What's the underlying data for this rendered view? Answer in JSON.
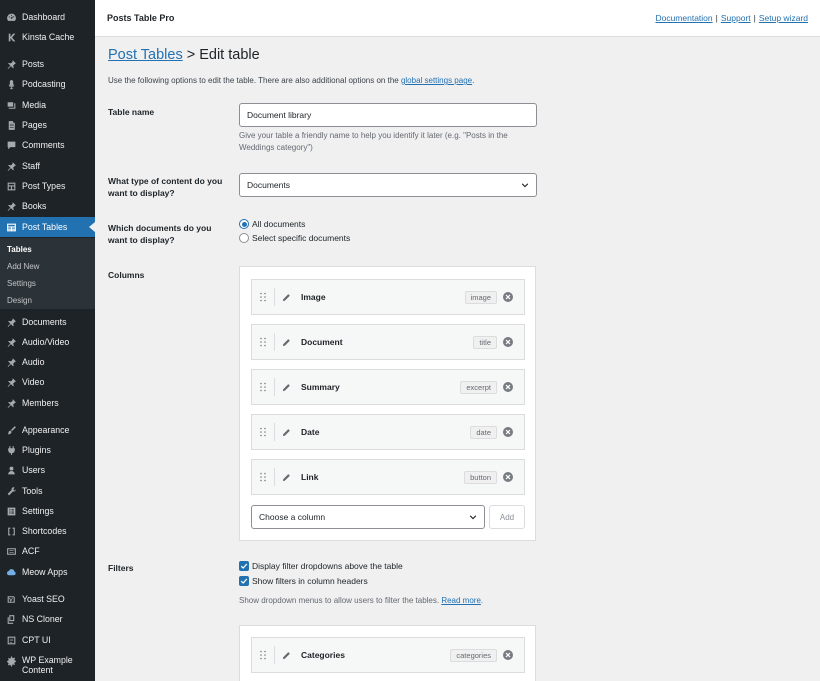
{
  "sidebar": {
    "items": [
      {
        "label": "Dashboard",
        "icon": "dashboard-icon"
      },
      {
        "label": "Kinsta Cache",
        "icon": "kinsta-icon"
      },
      {
        "label": "Posts",
        "icon": "pin-icon"
      },
      {
        "label": "Podcasting",
        "icon": "microphone-icon"
      },
      {
        "label": "Media",
        "icon": "media-icon"
      },
      {
        "label": "Pages",
        "icon": "pages-icon"
      },
      {
        "label": "Comments",
        "icon": "comments-icon"
      },
      {
        "label": "Staff",
        "icon": "pin-icon"
      },
      {
        "label": "Post Types",
        "icon": "post-types-icon"
      },
      {
        "label": "Books",
        "icon": "pin-icon"
      },
      {
        "label": "Post Tables",
        "icon": "table-icon"
      },
      {
        "label": "Documents",
        "icon": "pin-icon"
      },
      {
        "label": "Audio/Video",
        "icon": "pin-icon"
      },
      {
        "label": "Audio",
        "icon": "pin-icon"
      },
      {
        "label": "Video",
        "icon": "pin-icon"
      },
      {
        "label": "Members",
        "icon": "pin-icon"
      },
      {
        "label": "Appearance",
        "icon": "brush-icon"
      },
      {
        "label": "Plugins",
        "icon": "plugin-icon"
      },
      {
        "label": "Users",
        "icon": "users-icon"
      },
      {
        "label": "Tools",
        "icon": "wrench-icon"
      },
      {
        "label": "Settings",
        "icon": "settings-icon"
      },
      {
        "label": "Shortcodes",
        "icon": "shortcode-icon"
      },
      {
        "label": "ACF",
        "icon": "acf-icon"
      },
      {
        "label": "Meow Apps",
        "icon": "cloud-icon"
      },
      {
        "label": "Yoast SEO",
        "icon": "yoast-icon"
      },
      {
        "label": "NS Cloner",
        "icon": "cloner-icon"
      },
      {
        "label": "CPT UI",
        "icon": "cpt-icon"
      },
      {
        "label": "WP Example Content",
        "icon": "gear-icon"
      }
    ],
    "submenu": [
      "Tables",
      "Add New",
      "Settings",
      "Design"
    ]
  },
  "topbar": {
    "title": "Posts Table Pro",
    "links": [
      "Documentation",
      "Support",
      "Setup wizard"
    ],
    "separator": "|"
  },
  "page": {
    "heading_link": "Post Tables",
    "heading_rest": " > Edit table",
    "intro_text": "Use the following options to edit the table. There are also additional options on the ",
    "intro_link": "global settings page",
    "intro_end": "."
  },
  "form": {
    "table_name": {
      "label": "Table name",
      "value": "Document library",
      "help": "Give your table a friendly name to help you identify it later (e.g. \"Posts in the Weddings category\")"
    },
    "content_type": {
      "label": "What type of content do you want to display?",
      "value": "Documents"
    },
    "which_docs": {
      "label": "Which documents do you want to display?",
      "options": [
        "All documents",
        "Select specific documents"
      ],
      "selected": "All documents"
    },
    "columns": {
      "label": "Columns",
      "items": [
        {
          "name": "Image",
          "slug": "image"
        },
        {
          "name": "Document",
          "slug": "title"
        },
        {
          "name": "Summary",
          "slug": "excerpt"
        },
        {
          "name": "Date",
          "slug": "date"
        },
        {
          "name": "Link",
          "slug": "button"
        }
      ],
      "choose_placeholder": "Choose a column",
      "add_label": "Add"
    },
    "filters": {
      "label": "Filters",
      "checkboxes": [
        "Display filter dropdowns above the table",
        "Show filters in column headers"
      ],
      "help_text": "Show dropdown menus to allow users to filter the tables. ",
      "help_link": "Read more",
      "help_end": ".",
      "items": [
        {
          "name": "Categories",
          "slug": "categories"
        }
      ]
    }
  },
  "colors": {
    "sidebar_bg": "#1d2327",
    "accent": "#2271b1",
    "page_bg": "#f0f0f1"
  }
}
